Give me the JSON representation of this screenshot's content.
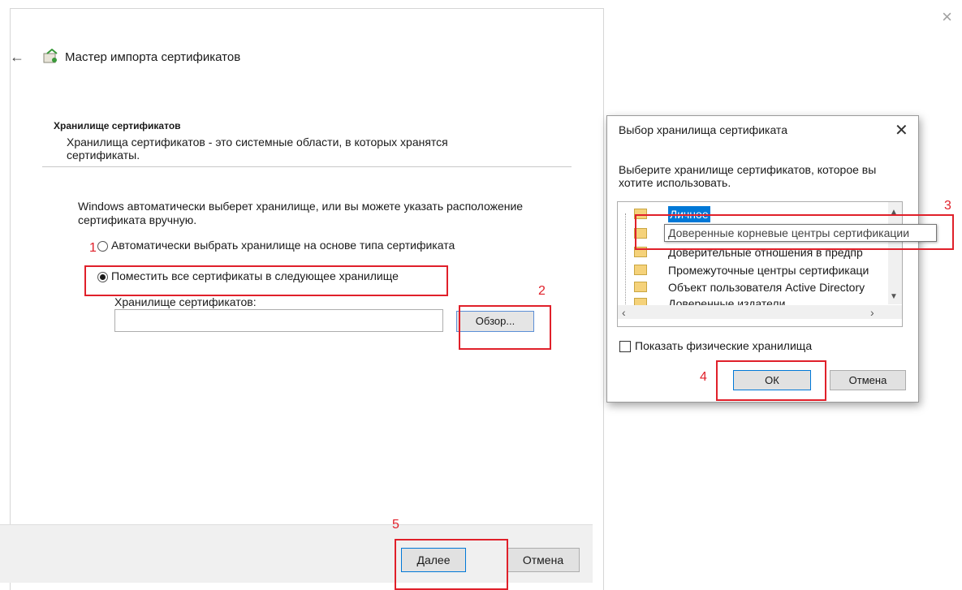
{
  "wizard": {
    "close_glyph": "×",
    "back_glyph": "←",
    "title": "Мастер импорта сертификатов",
    "section_title": "Хранилище сертификатов",
    "section_desc": "Хранилища сертификатов - это системные области, в которых хранятся сертификаты.",
    "body_text": "Windows автоматически выберет хранилище, или вы можете указать расположение сертификата вручную.",
    "radio_auto_label": "Автоматически выбрать хранилище на основе типа сертификата",
    "radio_manual_label": "Поместить все сертификаты в следующее хранилище",
    "selected_option": "manual",
    "store_label": "Хранилище сертификатов:",
    "store_value": "",
    "browse_label": "Обзор...",
    "next_label": "Далее",
    "cancel_label": "Отмена"
  },
  "dialog": {
    "title": "Выбор хранилища сертификата",
    "close_glyph": "✕",
    "desc": "Выберите хранилище сертификатов, которое вы хотите использовать.",
    "tree_items": [
      "Личное",
      "",
      "Доверительные отношения в предпр",
      "Промежуточные центры сертификаци",
      "Объект пользователя Active Directory",
      "Доверенные издатели"
    ],
    "tooltip": "Доверенные корневые центры сертификации",
    "show_physical_label": "Показать физические хранилища",
    "show_physical_checked": false,
    "ok_label": "ОК",
    "cancel_label": "Отмена"
  },
  "annotations": {
    "steps": [
      "1",
      "2",
      "3",
      "4",
      "5"
    ],
    "color": "#e0202a"
  },
  "colors": {
    "accent": "#0078d7",
    "folder": "#f5d27a"
  },
  "icons": {
    "wizard_title_icon": "certificate-icon",
    "folder_icon": "folder-icon"
  }
}
